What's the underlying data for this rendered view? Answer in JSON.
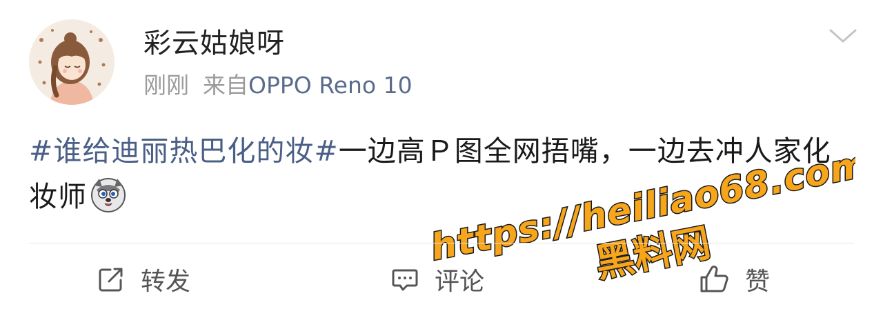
{
  "post": {
    "username": "彩云姑娘呀",
    "time": "刚刚",
    "source_prefix": "来自",
    "source_device": "OPPO Reno 10",
    "content": {
      "hashtag": "#谁给迪丽热巴化的妆#",
      "text": "一边高Ｐ图全网捂嘴，一边去冲人家化妆师",
      "emoji": "dog-emoji"
    }
  },
  "actions": {
    "repost_label": "转发",
    "comment_label": "评论",
    "like_label": "赞"
  },
  "watermark": {
    "url": "https://heiliao68.com",
    "name": "黑料网"
  },
  "colors": {
    "hashtag": "#4a5f86",
    "watermark_fill": "#f7a51b",
    "watermark_stroke": "#1a1a1a"
  }
}
